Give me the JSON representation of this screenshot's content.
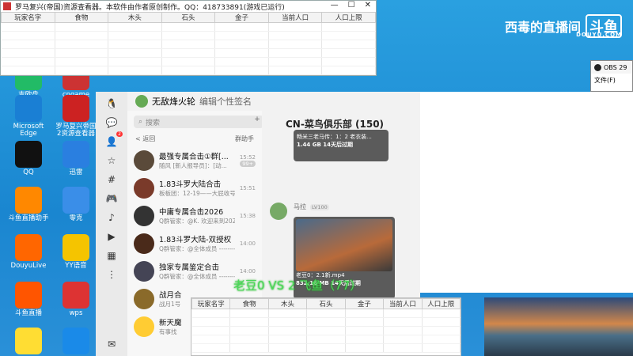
{
  "sheet": {
    "title": "罗马复兴(帝国)资源查看器。本软件由作者原创制作。QQ：418733891(游戏已运行)",
    "controls": [
      "—",
      "☐",
      "✕"
    ],
    "columns": [
      "玩家名字",
      "食物",
      "木头",
      "石头",
      "金子",
      "当前人口",
      "人口上限"
    ]
  },
  "watermark": {
    "text": "西毒的直播间",
    "logo": "斗鱼",
    "sub": "DOUYU.COM"
  },
  "desktop_icons": [
    {
      "label": "吉欧盘",
      "color": "#2b6"
    },
    {
      "label": "cngame",
      "color": "#c33"
    },
    {
      "label": "Microsoft Edge",
      "color": "#1a7fd4"
    },
    {
      "label": "罗马复兴帝国2资源查看器",
      "color": "#c22"
    },
    {
      "label": "QQ",
      "color": "#111"
    },
    {
      "label": "迅雷",
      "color": "#2a7fe0"
    },
    {
      "label": "斗鱼直播助手",
      "color": "#f80"
    },
    {
      "label": "零克",
      "color": "#3a8ee8"
    },
    {
      "label": "DouyuLive",
      "color": "#f60"
    },
    {
      "label": "YY语音",
      "color": "#f5c400"
    },
    {
      "label": "斗鱼直播",
      "color": "#f50"
    },
    {
      "label": "wps",
      "color": "#d33"
    },
    {
      "label": "",
      "color": "#fd3"
    },
    {
      "label": "",
      "color": "#1a8ae8"
    }
  ],
  "obs": {
    "title": "OBS 29",
    "menu": "文件(F)"
  },
  "qq": {
    "header_name": "无敌烽火轮",
    "header_sig": "编辑个性签名",
    "search_placeholder": "搜索",
    "back": "< 返回",
    "assistant": "群助手",
    "chats": [
      {
        "name": "最强专属合击①群[...",
        "preview": "随风 [新人报导员]：[动...",
        "time": "15:52",
        "pill": "99+",
        "color": "#5a4a3a"
      },
      {
        "name": "1.83斗罗大陆合击",
        "preview": "板板团：12-19——大屁收号",
        "time": "15:51",
        "pill": "",
        "color": "#7a3a2a"
      },
      {
        "name": "中庸专属合击2026",
        "preview": "Q群管家：@K. 欢迎来到2026...",
        "time": "15:38",
        "pill": "",
        "color": "#333"
      },
      {
        "name": "1.83斗罗大陆-双授权",
        "preview": "Q群管家：@全体成员 ---------",
        "time": "14:00",
        "pill": "",
        "color": "#4a2a1a"
      },
      {
        "name": "独家专属鉴定合击",
        "preview": "Q群管家：@全体成员 ---------",
        "time": "14:00",
        "pill": "",
        "color": "#445"
      },
      {
        "name": "战月合",
        "preview": "战月1号",
        "time": "",
        "pill": "",
        "color": "#8a6a2a"
      },
      {
        "name": "新天魔",
        "preview": "有事找",
        "time": "",
        "pill": "",
        "color": "#fc3"
      }
    ],
    "chat_title": "CN-菜鸟俱乐部 (150)",
    "file1": {
      "name": "畅米三老马传：1：2 老衣装...",
      "size": "1.44 GB  14天后过期"
    },
    "sender": {
      "name": "马拉",
      "level": "LV100"
    },
    "file2": {
      "name": "老豆0：2.1新.mp4",
      "size": "832.16 MB  14天后过期"
    }
  },
  "overlay": "老豆0 VS 2 飞鱼（77）"
}
